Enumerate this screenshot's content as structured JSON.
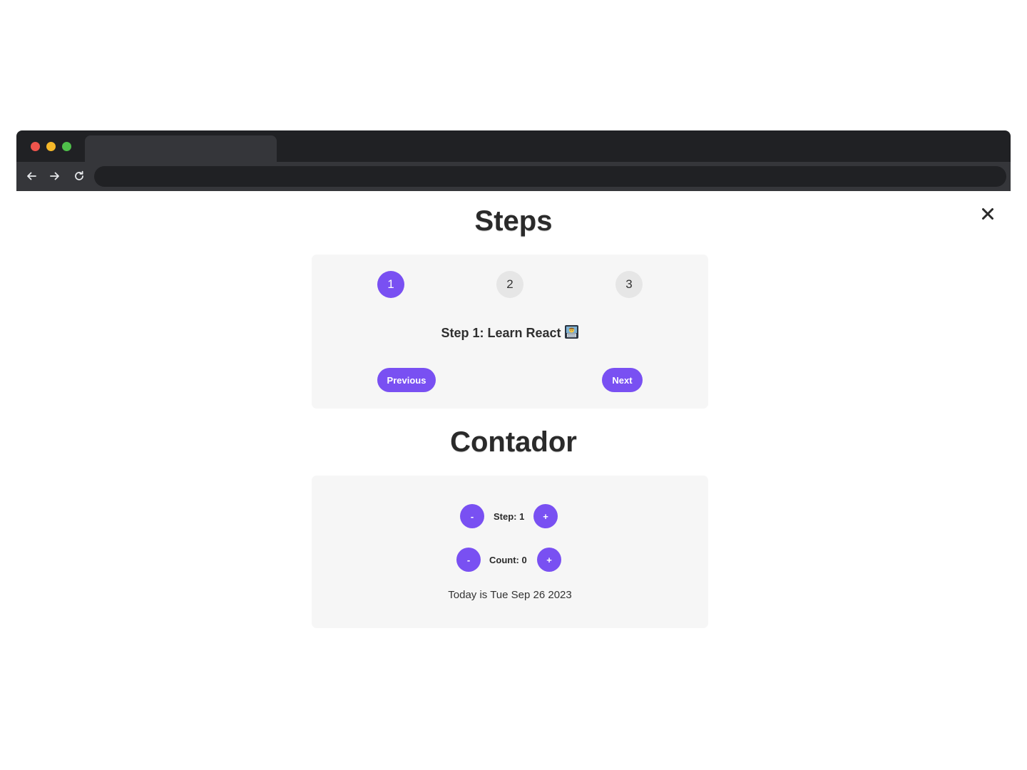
{
  "browser": {
    "back_icon": "arrow-left-icon",
    "forward_icon": "arrow-right-icon",
    "reload_icon": "reload-icon",
    "url": ""
  },
  "close_icon": "close-icon",
  "steps": {
    "title": "Steps",
    "numbers": [
      "1",
      "2",
      "3"
    ],
    "active_step": 1,
    "message": "Step 1: Learn React",
    "message_emoji_icon": "technologist-emoji-icon",
    "previous_label": "Previous",
    "next_label": "Next"
  },
  "counter": {
    "title": "Contador",
    "minus_label": "-",
    "plus_label": "+",
    "step_text": "Step: 1",
    "count_text": "Count: 0",
    "date_text": "Today is Tue Sep 26 2023"
  },
  "colors": {
    "accent": "#7950f2",
    "card_background": "#f6f6f6",
    "inactive_step": "#e6e6e6",
    "browser_frame": "#202124",
    "browser_toolbar": "#35363a"
  }
}
